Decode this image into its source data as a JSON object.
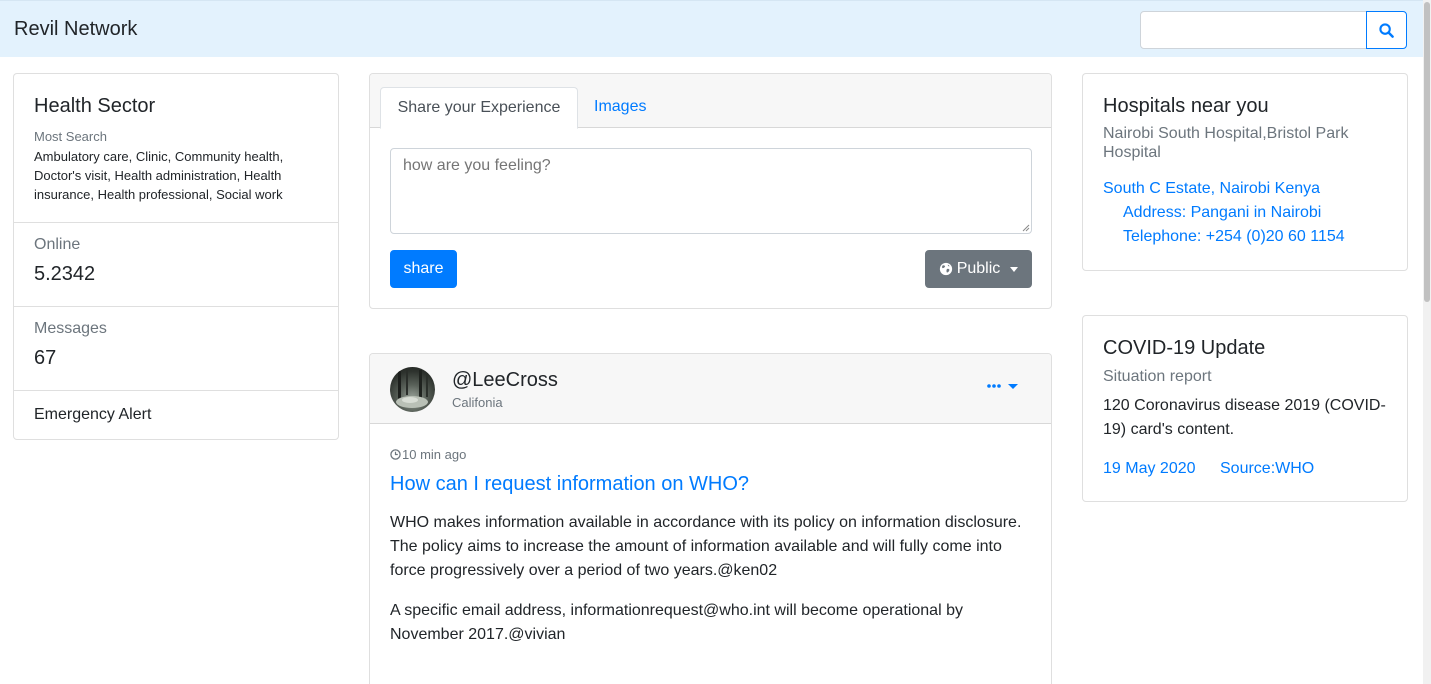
{
  "navbar": {
    "brand": "Revil Network",
    "search": {
      "value": "",
      "placeholder": ""
    },
    "search_icon": "search-icon"
  },
  "health": {
    "title": "Health Sector",
    "sub": "Most Search",
    "items": "Ambulatory care, Clinic, Community health, Doctor's visit, Health administration, Health insurance, Health professional, Social work"
  },
  "stats": {
    "online_label": "Online",
    "online_value": "5.2342",
    "messages_label": "Messages",
    "messages_value": "67",
    "alert": "Emergency Alert"
  },
  "share": {
    "tabs": [
      "Share your Experience",
      "Images"
    ],
    "placeholder": "how are you feeling?",
    "share_button": "share",
    "public_button": "Public",
    "public_icon": "globe-icon"
  },
  "post": {
    "user": "@LeeCross",
    "location": "Califonia",
    "time": "10 min ago",
    "time_icon": "clock-icon",
    "menu_icon": "ellipsis-icon",
    "title": "How can I request information on WHO?",
    "para1": "WHO makes information available in accordance with its policy on information disclosure. The policy aims to increase the amount of information available and will fully come into force progressively over a period of two years.@ken02",
    "para2": "A specific email address, informationrequest@who.int will become operational by November 2017.@vivian"
  },
  "hospitals": {
    "title": "Hospitals near you",
    "sub": "Nairobi South Hospital,Bristol Park Hospital",
    "link1": "South C Estate, Nairobi Kenya",
    "link2": "Address: Pangani in Nairobi",
    "link3": "Telephone: +254 (0)20 60 1154"
  },
  "covid": {
    "title": "COVID-19 Update",
    "sub": "Situation report",
    "text": "120 Coronavirus disease 2019 (COVID-19) card's content.",
    "date": "19 May 2020",
    "source": "Source:WHO"
  },
  "colors": {
    "navbar_bg": "#e3f2fd",
    "primary": "#007bff",
    "secondary": "#6c757d"
  }
}
